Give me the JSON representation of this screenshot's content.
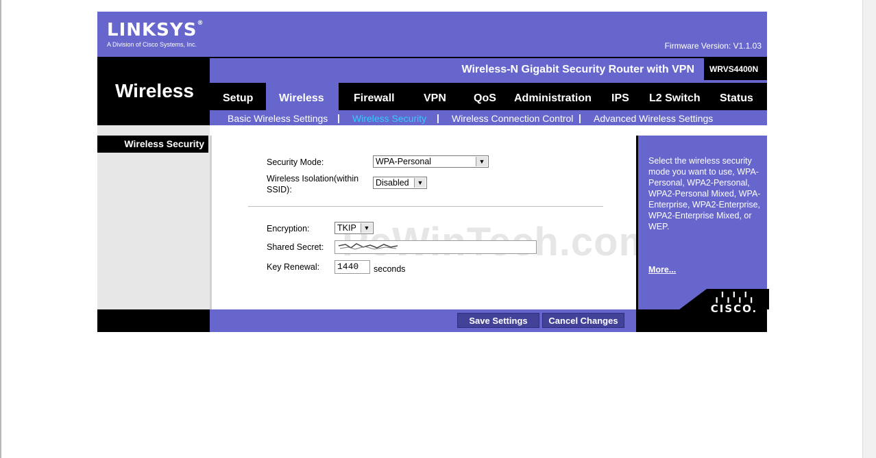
{
  "brand": {
    "logo": "LINKSYS",
    "subtitle": "A Division of Cisco Systems, Inc.",
    "firmware": "Firmware Version: V1.1.03"
  },
  "product": {
    "name": "Wireless-N Gigabit Security Router with VPN",
    "model": "WRVS4400N"
  },
  "section_title": "Wireless",
  "tabs": [
    {
      "label": "Setup"
    },
    {
      "label": "Wireless",
      "active": true
    },
    {
      "label": "Firewall"
    },
    {
      "label": "VPN"
    },
    {
      "label": "QoS"
    },
    {
      "label": "Administration"
    },
    {
      "label": "IPS"
    },
    {
      "label": "L2 Switch"
    },
    {
      "label": "Status"
    }
  ],
  "subtabs": [
    {
      "label": "Basic Wireless Settings"
    },
    {
      "label": "Wireless Security",
      "active": true
    },
    {
      "label": "Wireless Connection Control"
    },
    {
      "label": "Advanced Wireless Settings"
    }
  ],
  "sidebar_title": "Wireless Security",
  "form": {
    "security_mode_label": "Security Mode:",
    "security_mode_value": "WPA-Personal",
    "isolation_label_1": "Wireless Isolation(within",
    "isolation_label_2": "SSID):",
    "isolation_value": "Disabled",
    "encryption_label": "Encryption:",
    "encryption_value": "TKIP",
    "shared_secret_label": "Shared Secret:",
    "key_renewal_label": "Key Renewal:",
    "key_renewal_value": "1440",
    "key_renewal_unit": "seconds"
  },
  "watermark": "PcWinTech.com",
  "help": {
    "text": "Select the wireless security mode you want to use, WPA-Personal, WPA2-Personal, WPA2-Personal Mixed, WPA-Enterprise, WPA2-Enterprise, WPA2-Enterprise Mixed, or WEP.",
    "more": "More..."
  },
  "buttons": {
    "save": "Save Settings",
    "cancel": "Cancel Changes"
  },
  "cisco": {
    "word": "CISCO."
  },
  "colors": {
    "accent": "#6666cc",
    "active_subtab": "#33ccff",
    "button": "#424299"
  }
}
